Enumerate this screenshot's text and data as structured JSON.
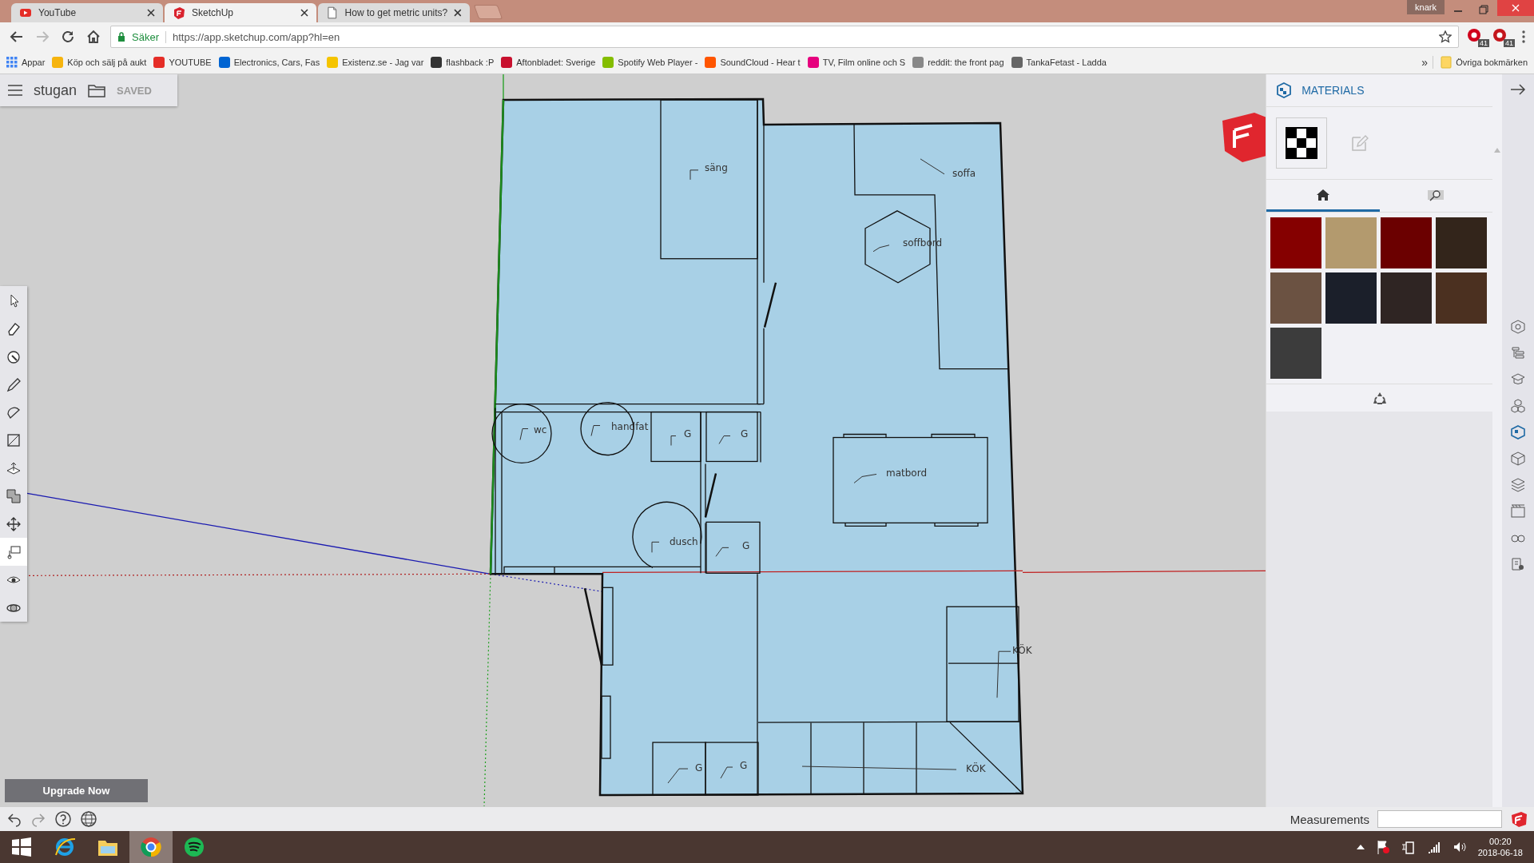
{
  "browser": {
    "tabs": [
      {
        "title": "YouTube",
        "kind": "youtube",
        "selected": false
      },
      {
        "title": "SketchUp",
        "kind": "sketchup",
        "selected": true
      },
      {
        "title": "How to get metric units?",
        "kind": "page",
        "selected": false
      }
    ],
    "user": "knark",
    "address": {
      "security": "Säker",
      "url": "https://app.sketchup.com/app?hl=en"
    },
    "extensions": [
      {
        "badge": "41",
        "color": "#d0021b"
      },
      {
        "badge": "41",
        "color": "#c4161c"
      }
    ],
    "bookmarks": [
      {
        "label": "Appar",
        "color": "#4285f4"
      },
      {
        "label": "Köp och sälj på aukt",
        "color": "#f6b40e"
      },
      {
        "label": "YOUTUBE",
        "color": "#e52d27"
      },
      {
        "label": "Electronics, Cars, Fas",
        "color": "#0064d2"
      },
      {
        "label": "Existenz.se - Jag var",
        "color": "#f5c400"
      },
      {
        "label": "flashback :P",
        "color": "#333333"
      },
      {
        "label": "Aftonbladet: Sverige",
        "color": "#c8102e"
      },
      {
        "label": "Spotify Web Player -",
        "color": "#84bd00"
      },
      {
        "label": "SoundCloud - Hear t",
        "color": "#ff5500"
      },
      {
        "label": "TV, Film online och S",
        "color": "#e6007e"
      },
      {
        "label": "reddit: the front pag",
        "color": "#888888"
      },
      {
        "label": "TankaFetast - Ladda",
        "color": "#666666"
      }
    ],
    "more": "»",
    "other_bookmarks": "Övriga bokmärken"
  },
  "app": {
    "file_bar": {
      "name": "stugan",
      "status": "SAVED"
    },
    "tools": [
      {
        "kind": "select",
        "selected": false
      },
      {
        "kind": "eraser",
        "selected": false
      },
      {
        "kind": "paint",
        "selected": false
      },
      {
        "kind": "pencil",
        "selected": false
      },
      {
        "kind": "arc",
        "selected": false
      },
      {
        "kind": "rectangle",
        "selected": false
      },
      {
        "kind": "pushpull",
        "selected": false
      },
      {
        "kind": "offset",
        "selected": false
      },
      {
        "kind": "move",
        "selected": false
      },
      {
        "kind": "text",
        "selected": true
      },
      {
        "kind": "look",
        "selected": false
      },
      {
        "kind": "orbit",
        "selected": false
      }
    ],
    "plan_labels": [
      "säng",
      "soffa",
      "soffbord",
      "wc",
      "handfat",
      "G",
      "G",
      "matbord",
      "dusch",
      "G",
      "KÖK",
      "G",
      "G",
      "KÖK"
    ],
    "panel": {
      "title": "MATERIALS",
      "tabs": [
        {
          "kind": "home",
          "selected": true
        },
        {
          "kind": "search",
          "selected": false
        }
      ],
      "swatches": [
        {
          "color": "#850000"
        },
        {
          "color": "#b39a6e"
        },
        {
          "color": "#6b0000"
        },
        {
          "color": "#33251b"
        },
        {
          "color": "#6b5242"
        },
        {
          "color": "#1b1f2a"
        },
        {
          "color": "#2f2523"
        },
        {
          "color": "#4b3020"
        },
        {
          "color": "#3c3c3c"
        }
      ]
    },
    "side_icons": [
      {
        "kind": "instructor",
        "selected": false
      },
      {
        "kind": "outliner",
        "selected": false
      },
      {
        "kind": "learn",
        "selected": false
      },
      {
        "kind": "components",
        "selected": false
      },
      {
        "kind": "materials",
        "selected": true
      },
      {
        "kind": "styles",
        "selected": false
      },
      {
        "kind": "layers",
        "selected": false
      },
      {
        "kind": "scenes",
        "selected": false
      },
      {
        "kind": "display",
        "selected": false
      },
      {
        "kind": "entity",
        "selected": false
      }
    ],
    "upgrade_button": "Upgrade Now",
    "measurements": {
      "label": "Measurements"
    }
  },
  "taskbar": {
    "apps": [
      {
        "kind": "start",
        "selected": false
      },
      {
        "kind": "ie",
        "selected": false
      },
      {
        "kind": "explorer",
        "selected": false
      },
      {
        "kind": "chrome",
        "selected": true
      },
      {
        "kind": "spotify",
        "selected": false
      }
    ],
    "time": "00:20",
    "date": "2018-06-18"
  }
}
